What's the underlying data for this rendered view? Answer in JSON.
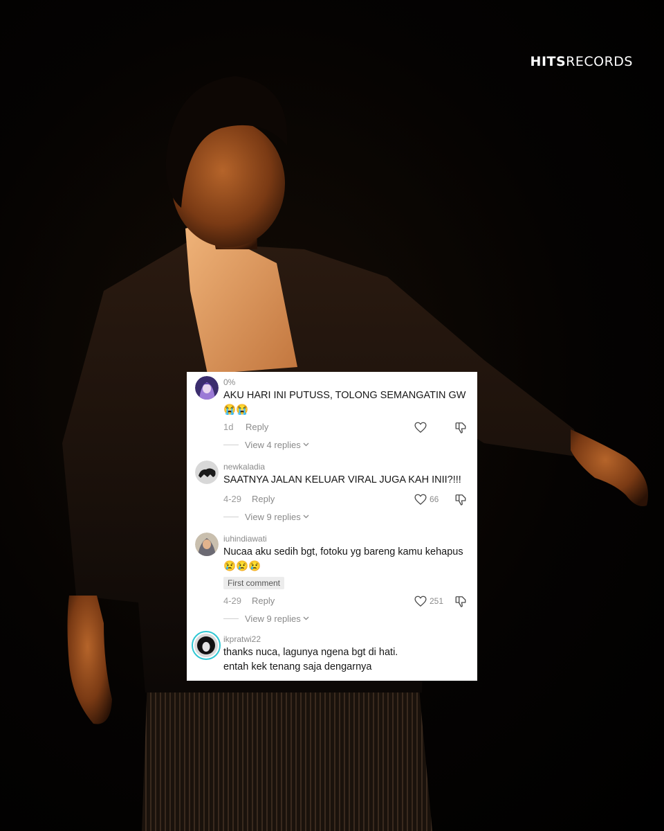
{
  "brand": {
    "logo_bold": "HITS",
    "logo_light": "RECORDS"
  },
  "colors": {
    "card_bg": "#ffffff",
    "text": "#161616",
    "muted": "#8a8a8a",
    "story_ring": "#2fc7d3"
  },
  "comments": [
    {
      "username": "0%",
      "text": "AKU HARI INI PUTUSS, TOLONG SEMANGATIN GW 😭😭",
      "date": "1d",
      "reply_label": "Reply",
      "likes": "",
      "view_replies": "View 4 replies",
      "avatar_icon": "purple-anime-avatar"
    },
    {
      "username": "newkaladia",
      "text": "SAATNYA JALAN KELUAR VIRAL JUGA KAH INII?!!!",
      "date": "4-29",
      "reply_label": "Reply",
      "likes": "66",
      "view_replies": "View 9 replies",
      "avatar_icon": "dark-creature-avatar"
    },
    {
      "username": "iuhindiawati",
      "text": "Nucaa aku sedih bgt, fotoku yg bareng kamu kehapus😢😢😢",
      "badge": "First comment",
      "date": "4-29",
      "reply_label": "Reply",
      "likes": "251",
      "view_replies": "View 9 replies",
      "avatar_icon": "hijab-woman-avatar"
    },
    {
      "username": "ikpratwi22",
      "text": "thanks nuca, lagunya ngena bgt di hati.\nentah kek tenang saja dengarnya",
      "avatar_icon": "portrait-avatar-with-story-ring"
    }
  ]
}
